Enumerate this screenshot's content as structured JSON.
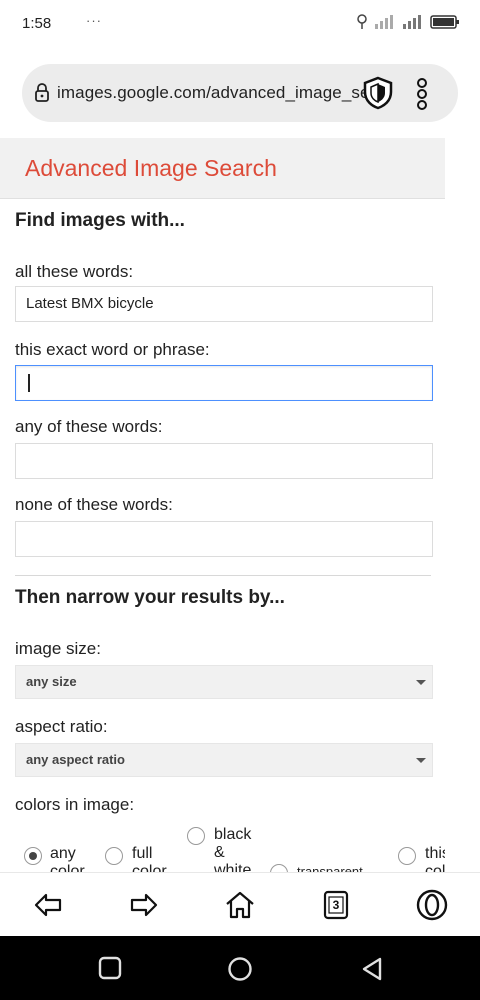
{
  "status_bar": {
    "time": "1:58",
    "dots": "···",
    "icons": [
      "location-pin-icon",
      "signal-icon",
      "signal-icon",
      "battery-icon"
    ]
  },
  "address_bar": {
    "url": "images.google.com/advanced_image_search",
    "icons": [
      "lock-icon",
      "shield-icon",
      "menu-dots-icon"
    ]
  },
  "page": {
    "title": "Advanced Image Search",
    "find_heading": "Find images with...",
    "all_words_label": "all these words:",
    "all_words_value": "Latest BMX bicycle",
    "exact_label": "this exact word or phrase:",
    "exact_value": "",
    "any_words_label": "any of these words:",
    "any_words_value": "",
    "none_words_label": "none of these words:",
    "none_words_value": "",
    "narrow_heading": "Then narrow your results by...",
    "image_size_label": "image size:",
    "image_size_value": "any size",
    "aspect_label": "aspect ratio:",
    "aspect_value": "any aspect ratio",
    "colors_label": "colors in image:",
    "color_options": [
      {
        "label": "any color",
        "checked": true
      },
      {
        "label": "full color",
        "checked": false
      },
      {
        "label": "black & white",
        "checked": false
      },
      {
        "label": "transparent",
        "checked": false
      },
      {
        "label": "this color:",
        "checked": false
      }
    ]
  },
  "bottom_nav": {
    "tab_count": "3",
    "icons": [
      "back-arrow-icon",
      "forward-arrow-icon",
      "home-icon",
      "tabs-icon",
      "opera-icon"
    ]
  },
  "system_nav": {
    "icons": [
      "recents-icon",
      "home-circle-icon",
      "back-triangle-icon"
    ]
  },
  "colors": {
    "accent_red": "#dd4b39",
    "focus_blue": "#4d90fe"
  }
}
